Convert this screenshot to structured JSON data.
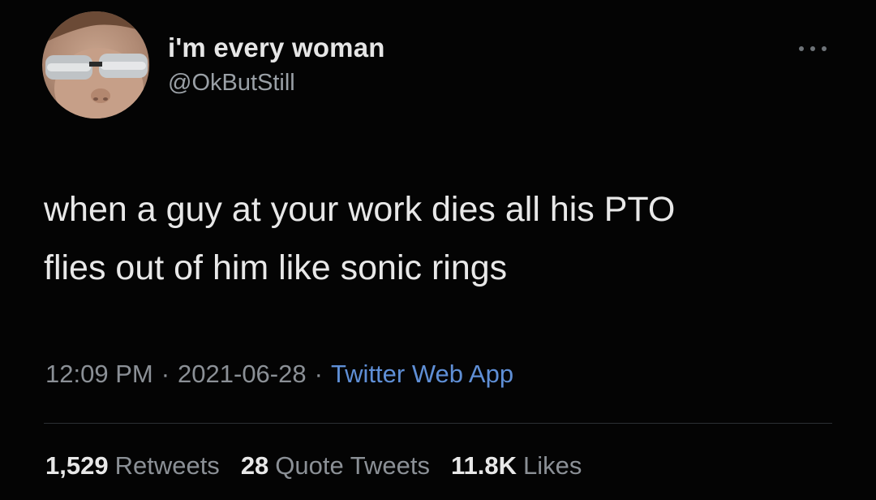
{
  "tweet": {
    "display_name": "i'm every woman",
    "handle": "@OkButStill",
    "text_lines": [
      "when a guy at your work dies all his PTO",
      "flies out of him like sonic rings"
    ],
    "time": "12:09 PM",
    "separator": "·",
    "date": "2021-06-28",
    "source": "Twitter Web App",
    "stats": {
      "retweets": {
        "count": "1,529",
        "label": "Retweets"
      },
      "quote_tweets": {
        "count": "28",
        "label": "Quote Tweets"
      },
      "likes": {
        "count": "11.8K",
        "label": "Likes"
      }
    },
    "more_icon": "more-horizontal-icon"
  },
  "colors": {
    "background": "#040404",
    "text": "#e8e8e8",
    "secondary_text": "#8b9096",
    "link": "#5f8fd6"
  }
}
